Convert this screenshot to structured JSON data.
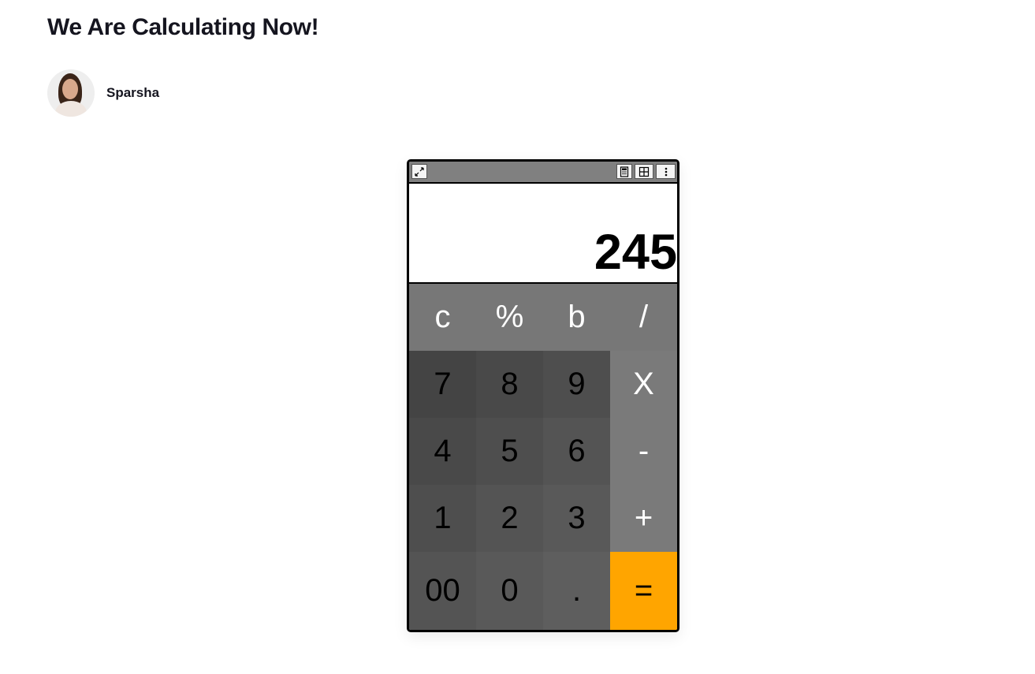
{
  "page": {
    "title": "We Are Calculating Now!"
  },
  "author": {
    "name": "Sparsha"
  },
  "calculator": {
    "titlebar": {
      "left_icon": "minimize-arrows-icon",
      "right_icons": [
        "calculator-icon",
        "grid-icon",
        "more-vertical-icon"
      ]
    },
    "display": "245",
    "rows": [
      [
        "c",
        "%",
        "b",
        "/"
      ],
      [
        "7",
        "8",
        "9",
        "X"
      ],
      [
        "4",
        "5",
        "6",
        "-"
      ],
      [
        "1",
        "2",
        "3",
        "+"
      ],
      [
        "00",
        "0",
        ".",
        "="
      ]
    ],
    "colors": {
      "top_row": "#777777",
      "operator": "#7a7a7a",
      "equals": "#ffa500",
      "number_pad_dark": "#444444",
      "number_pad_light": "#5e5e5e"
    }
  }
}
